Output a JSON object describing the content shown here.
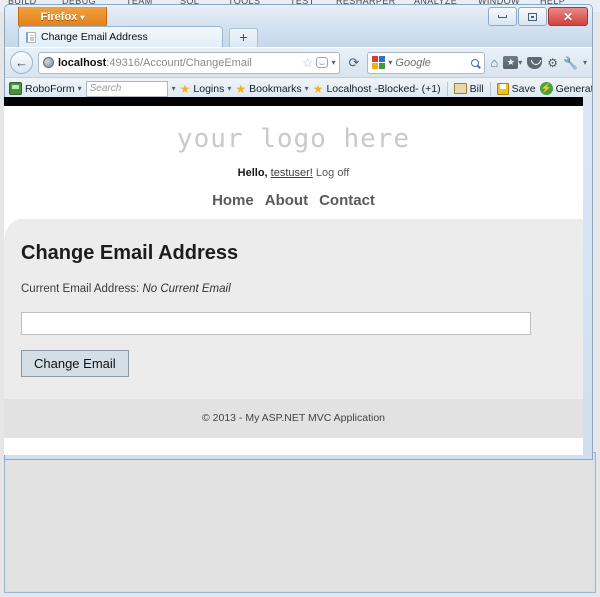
{
  "ide": {
    "menu_items": [
      "BUILD",
      "DEBUG",
      "TEAM",
      "SQL",
      "TOOLS",
      "TEST",
      "RESHARPER",
      "ANALYZE",
      "WINDOW",
      "HELP"
    ]
  },
  "browser": {
    "app_button": "Firefox",
    "app_button_caret": "▾",
    "tab": {
      "title": "Change Email Address",
      "new_tab_label": "+"
    },
    "window_controls": {
      "minimize": "minimize",
      "maximize": "restore",
      "close": "✕"
    },
    "nav": {
      "back_glyph": "←",
      "url_host": "localhost",
      "url_rest": ":49316/Account/ChangeEmail",
      "url_full": "localhost:49316/Account/ChangeEmail",
      "star_glyph": "☆",
      "reload_glyph": "⟳",
      "dropdown_caret": "▾"
    },
    "search": {
      "engine": "Google",
      "placeholder": "Google"
    },
    "toolbar_icons": {
      "home": "⌂",
      "bookmark": "★",
      "pocket": "pocket",
      "overflow_caret": "▾"
    },
    "roboform": {
      "brand": "RoboForm",
      "brand_caret": "▾",
      "search_placeholder": "Search",
      "search_caret": "▾",
      "logins": "Logins",
      "logins_caret": "▾",
      "bookmarks": "Bookmarks",
      "bookmarks_caret": "▾",
      "matching": "Localhost -Blocked-",
      "matching_count": "(+1)",
      "bill": "Bill",
      "save": "Save",
      "generate": "Generate"
    }
  },
  "page": {
    "logo_text": "your logo here",
    "login": {
      "greeting": "Hello,",
      "username": "testuser!",
      "logoff": "Log off"
    },
    "nav_links": [
      "Home",
      "About",
      "Contact"
    ],
    "heading": "Change Email Address",
    "current_email_label": "Current Email Address:",
    "current_email_value": "No Current Email",
    "email_input_value": "",
    "email_input_placeholder": "",
    "submit_button": "Change Email",
    "footer": "© 2013 - My ASP.NET MVC Application"
  },
  "colors": {
    "firefox_orange": "#e1801b",
    "page_topbar": "#000000",
    "page_body": "#ececec",
    "logo_gray": "#c9c9c9",
    "button_face": "#d3dee6",
    "close_red": "#cf4340"
  }
}
